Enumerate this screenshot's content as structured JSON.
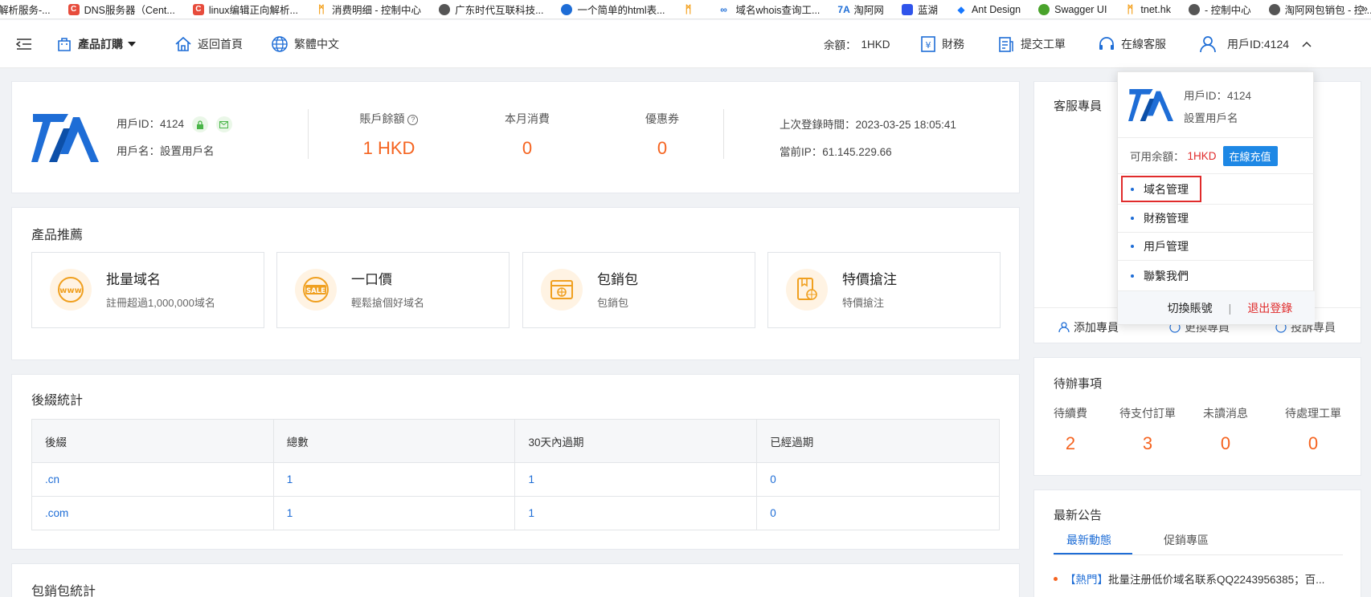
{
  "bookmarks": [
    {
      "label": "解析服务-...",
      "icon": "page-icon",
      "color": "#ffffff"
    },
    {
      "label": "DNS服务器（Cent...",
      "icon": "csdn-icon",
      "color": "#e74c3c"
    },
    {
      "label": "linux编辑正向解析...",
      "icon": "csdn-icon",
      "color": "#e74c3c"
    },
    {
      "label": "消费明细 - 控制中心",
      "icon": "swirl-icon",
      "color": "#f39c12"
    },
    {
      "label": "广东时代互联科技...",
      "icon": "globe-icon",
      "color": "#555555"
    },
    {
      "label": "一个简单的html表...",
      "icon": "paw-icon",
      "color": "#1e6dd6"
    },
    {
      "label": "",
      "icon": "swirl-icon",
      "color": "#f39c12"
    },
    {
      "label": "域名whois查询工...",
      "icon": "infinity-icon",
      "color": "#1e6dd6"
    },
    {
      "label": "淘阿网",
      "icon": "logo-icon",
      "color": "#1e6dd6"
    },
    {
      "label": "蓝湖",
      "icon": "lanhu-icon",
      "color": "#2f54eb"
    },
    {
      "label": "Ant Design",
      "icon": "antd-icon",
      "color": "#1677ff"
    },
    {
      "label": "Swagger UI",
      "icon": "swagger-icon",
      "color": "#85ea2d"
    },
    {
      "label": "tnet.hk",
      "icon": "swirl-icon",
      "color": "#f39c12"
    },
    {
      "label": "- 控制中心",
      "icon": "globe-icon",
      "color": "#555555"
    },
    {
      "label": "淘阿网包销包 - 控...",
      "icon": "globe-icon",
      "color": "#555555"
    }
  ],
  "bookmarks_more": "»",
  "header": {
    "products": "產品訂購",
    "home": "返回首頁",
    "language": "繁體中文",
    "balance_label": "余額：",
    "balance_value": "1HKD",
    "finance": "財務",
    "ticket": "提交工單",
    "support": "在線客服",
    "user": "用戶ID:4124"
  },
  "overview": {
    "user_id": "用戶ID：4124",
    "username": "用戶名：設置用戶名",
    "balance_label": "賬戶餘額",
    "balance_value": "1 HKD",
    "month_label": "本月消費",
    "month_value": "0",
    "coupon_label": "優惠券",
    "coupon_value": "0",
    "last_login": "上次登錄時間：2023-03-25 18:05:41",
    "current_ip": "當前IP：61.145.229.66"
  },
  "products": {
    "title": "產品推薦",
    "items": [
      {
        "name": "批量域名",
        "desc": "註冊超過1,000,000域名",
        "icon": "www-icon"
      },
      {
        "name": "一口價",
        "desc": "輕鬆搶個好域名",
        "icon": "sale-icon"
      },
      {
        "name": "包銷包",
        "desc": "包銷包",
        "icon": "package-icon"
      },
      {
        "name": "特價搶注",
        "desc": "特價搶注",
        "icon": "special-icon"
      }
    ]
  },
  "suffix_stats": {
    "title": "後綴統計",
    "columns": [
      "後綴",
      "總數",
      "30天內過期",
      "已經過期"
    ],
    "rows": [
      [
        ".cn",
        "1",
        "1",
        "0"
      ],
      [
        ".com",
        "1",
        "1",
        "0"
      ]
    ]
  },
  "package_stats": {
    "title": "包銷包統計"
  },
  "service": {
    "title": "客服專員",
    "add": "添加專員",
    "change": "更換專員",
    "complain": "投訴專員"
  },
  "todo": {
    "title": "待辦事項",
    "items": [
      {
        "label": "待續費",
        "value": "2"
      },
      {
        "label": "待支付訂單",
        "value": "3"
      },
      {
        "label": "未讀消息",
        "value": "0"
      },
      {
        "label": "待處理工單",
        "value": "0"
      }
    ]
  },
  "announcements": {
    "title": "最新公告",
    "tabs": [
      "最新動態",
      "促銷專區"
    ],
    "items": [
      {
        "tag": "【熱門】",
        "text": "批量注册低价域名联系QQ2243956385；百..."
      }
    ]
  },
  "dropdown": {
    "user_id": "用戶ID：4124",
    "username": "設置用戶名",
    "available_label": "可用余額：",
    "available_value": "1HKD",
    "recharge": "在線充值",
    "menu": [
      "域名管理",
      "財務管理",
      "用戶管理",
      "聯繫我們"
    ],
    "switch_account": "切換賬號",
    "separator": "|",
    "logout": "退出登錄"
  },
  "colors": {
    "accent": "#1e6dd6",
    "orange": "#f5631f",
    "danger": "#e02b2b"
  }
}
